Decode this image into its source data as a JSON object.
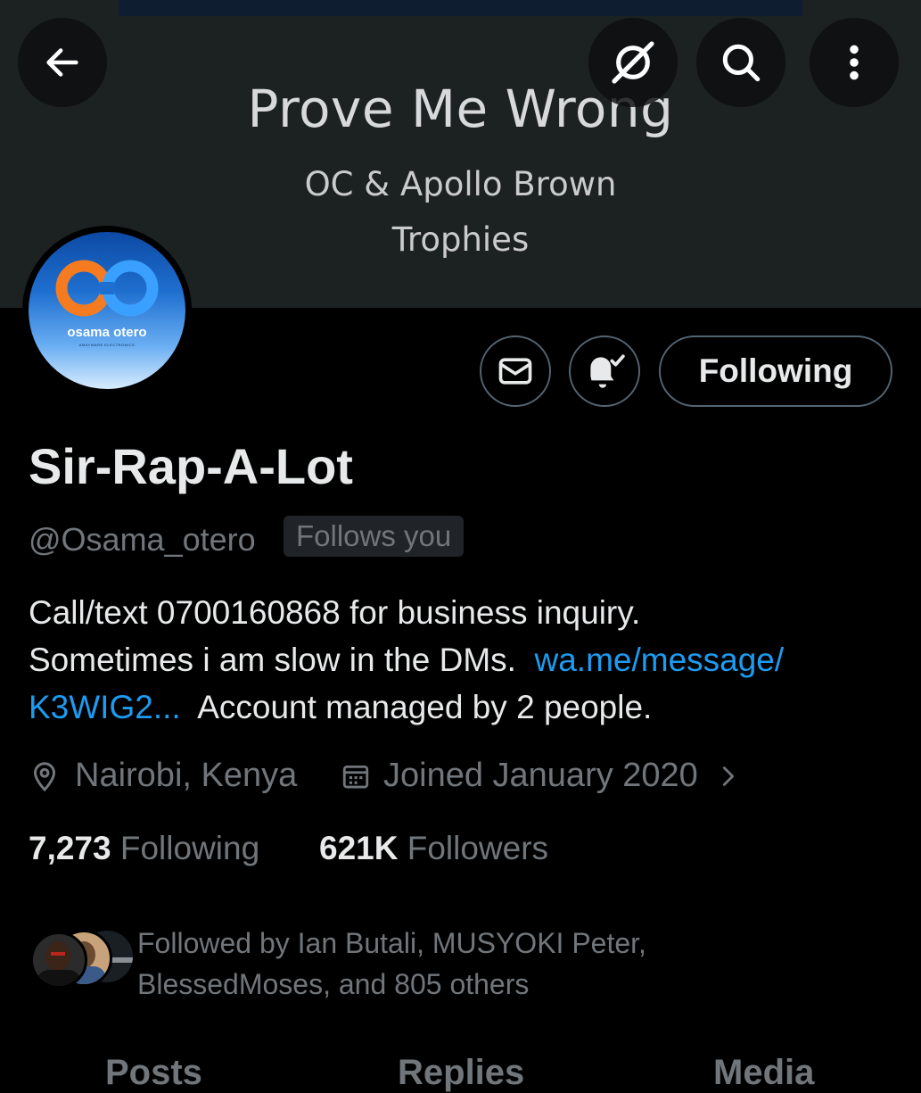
{
  "banner": {
    "title": "Prove Me Wrong",
    "artist": "OC & Apollo Brown",
    "album": "Trophies"
  },
  "avatar": {
    "text": "osama otero",
    "subtext": "AMAYWARE ELECTRONICS"
  },
  "profile": {
    "display_name": "Sir-Rap-A-Lot",
    "handle": "@Osama_otero",
    "follows_you_badge": "Follows you",
    "bio": {
      "line1": "Call/text 0700160868 for business inquiry.",
      "line2_text": "Sometimes i am slow in the DMs.",
      "link_part1": "wa.me/message/",
      "link_part2": "K3WIG2...",
      "line3_text": "Account managed by 2 people."
    },
    "location": "Nairobi, Kenya",
    "joined": "Joined January 2020",
    "following_count": "7,273",
    "following_label": "Following",
    "followers_count": "621K",
    "followers_label": "Followers",
    "followed_by_line1": "Followed by Ian Butali, MUSYOKI Peter,",
    "followed_by_line2": "BlessedMoses, and 805 others"
  },
  "actions": {
    "following_button": "Following"
  },
  "tabs": [
    "Posts",
    "Replies",
    "Media"
  ],
  "icons": {
    "back": "arrow-left-icon",
    "grok": "grok-icon",
    "search": "search-icon",
    "more": "more-vertical-icon",
    "message": "envelope-icon",
    "notify": "bell-check-icon",
    "location": "location-pin-icon",
    "calendar": "calendar-icon",
    "chevron": "chevron-right-icon"
  },
  "colors": {
    "accent_link": "#1d9bf0",
    "text_primary": "#e7e9ea",
    "text_secondary": "#71767b",
    "avatar_logo": "#f47b20"
  }
}
